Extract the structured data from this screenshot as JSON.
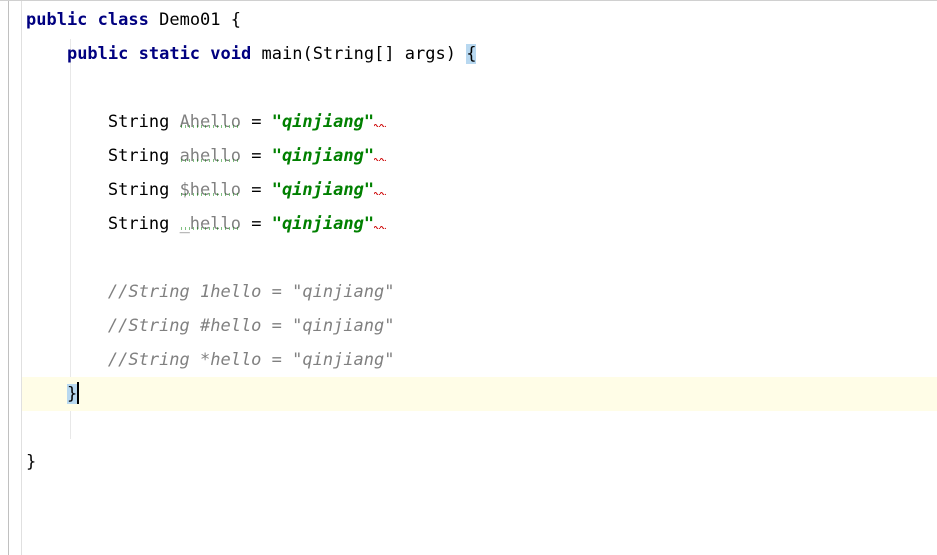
{
  "code": {
    "line1": {
      "kw1": "public",
      "kw2": "class",
      "classname": "Demo01",
      "brace": "{"
    },
    "line2": {
      "kw1": "public",
      "kw2": "static",
      "kw3": "void",
      "method": "main",
      "params": "(String[] args)",
      "brace": "{"
    },
    "line4": {
      "type": "String",
      "ident": "Ahello",
      "eq": " = ",
      "str": "\"qinjiang\"",
      "semi": ";"
    },
    "line5": {
      "type": "String",
      "ident": "ahello",
      "eq": " = ",
      "str": "\"qinjiang\"",
      "semi": ";"
    },
    "line6": {
      "type": "String",
      "ident": "$hello",
      "eq": " = ",
      "str": "\"qinjiang\"",
      "semi": ";"
    },
    "line7": {
      "type": "String",
      "ident": "_hello",
      "eq": " = ",
      "str": "\"qinjiang\"",
      "semi": ";"
    },
    "line9": "//String 1hello = \"qinjiang\"",
    "line10": "//String #hello = \"qinjiang\"",
    "line11": "//String *hello = \"qinjiang\"",
    "line12": "}",
    "line14": "}"
  }
}
